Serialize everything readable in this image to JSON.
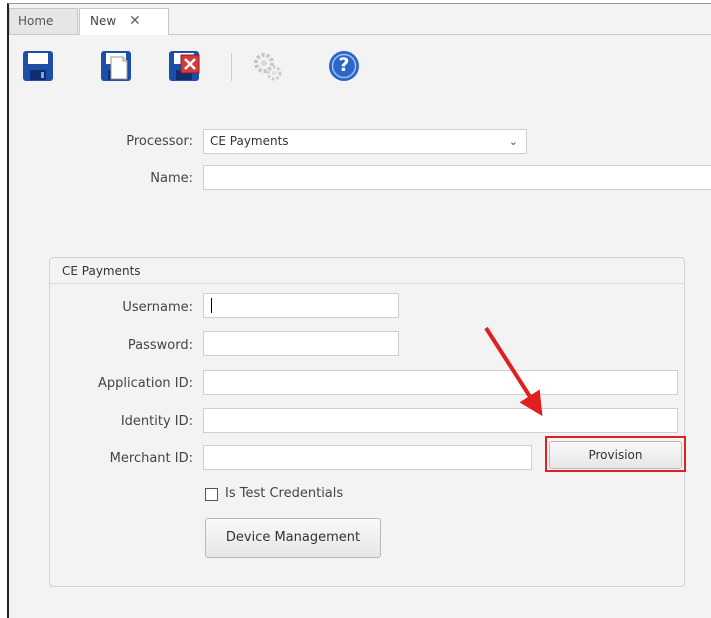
{
  "tabs": [
    {
      "label": "Home"
    },
    {
      "label": "New",
      "close_glyph": "✕"
    }
  ],
  "toolbar": {
    "icons": [
      "save-icon",
      "save-new-icon",
      "save-close-icon",
      "gears-icon",
      "help-icon"
    ],
    "help_glyph": "?"
  },
  "form": {
    "processor_label": "Processor:",
    "processor_value": "CE Payments",
    "processor_arrow": "⌄",
    "name_label": "Name:",
    "name_value": ""
  },
  "group": {
    "title": "CE Payments",
    "username_label": "Username:",
    "username_value": "",
    "password_label": "Password:",
    "password_value": "",
    "application_id_label": "Application ID:",
    "application_id_value": "",
    "identity_id_label": "Identity ID:",
    "identity_id_value": "",
    "merchant_id_label": "Merchant ID:",
    "merchant_id_value": "",
    "provision_button": "Provision",
    "test_credentials_label": "Is Test Credentials",
    "test_credentials_checked": false,
    "device_management_button": "Device Management"
  },
  "colors": {
    "highlight": "#e02020",
    "arrow": "#e02020",
    "help_blue": "#2b66c8",
    "save_blue": "#1e4fa8",
    "close_red": "#d33a3a"
  }
}
